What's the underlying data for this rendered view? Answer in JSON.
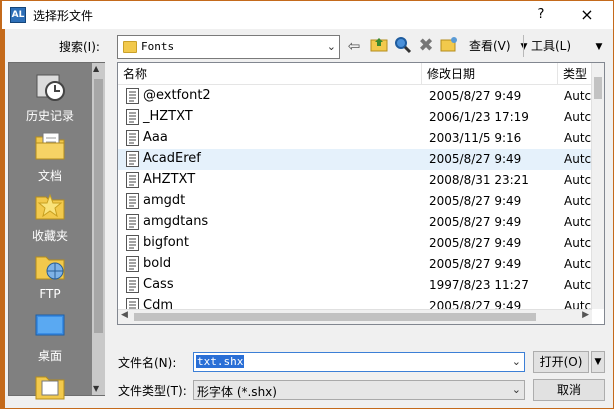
{
  "window": {
    "title": "选择形文件",
    "help_label": "?",
    "close_label": "×",
    "app_icon_text": "AL"
  },
  "toolbar": {
    "search_label": "搜索(I):",
    "current_folder": "Fonts",
    "view_label": "查看(V)",
    "tools_label": "工具(L)",
    "icons": [
      "back-icon",
      "up-folder-icon",
      "search-web-icon",
      "delete-icon",
      "new-folder-icon"
    ]
  },
  "places": [
    {
      "label": "历史记录",
      "icon": "history-icon"
    },
    {
      "label": "文档",
      "icon": "documents-icon"
    },
    {
      "label": "收藏夹",
      "icon": "favorites-icon"
    },
    {
      "label": "FTP",
      "icon": "ftp-icon"
    },
    {
      "label": "桌面",
      "icon": "desktop-icon"
    }
  ],
  "file_list": {
    "columns": [
      "名称",
      "修改日期",
      "类型"
    ],
    "selected_index": 3,
    "rows": [
      {
        "name": "@extfont2",
        "date": "2005/8/27 9:49",
        "type": "Autc"
      },
      {
        "name": "_HZTXT",
        "date": "2006/1/23 17:19",
        "type": "Autc"
      },
      {
        "name": "Aaa",
        "date": "2003/11/5 9:16",
        "type": "Autc"
      },
      {
        "name": "AcadEref",
        "date": "2005/8/27 9:49",
        "type": "Autc"
      },
      {
        "name": "AHZTXT",
        "date": "2008/8/31 23:21",
        "type": "Autc"
      },
      {
        "name": "amgdt",
        "date": "2005/8/27 9:49",
        "type": "Autc"
      },
      {
        "name": "amgdtans",
        "date": "2005/8/27 9:49",
        "type": "Autc"
      },
      {
        "name": "bigfont",
        "date": "2005/8/27 9:49",
        "type": "Autc"
      },
      {
        "name": "bold",
        "date": "2005/8/27 9:49",
        "type": "Autc"
      },
      {
        "name": "Cass",
        "date": "1997/8/23 11:27",
        "type": "Autc"
      },
      {
        "name": "Cdm",
        "date": "2005/8/27 9:49",
        "type": "Autc"
      }
    ]
  },
  "footer": {
    "filename_label": "文件名(N):",
    "filename_value": "txt.shx",
    "filetype_label": "文件类型(T):",
    "filetype_value": "形字体 (*.shx)",
    "open_label": "打开(O)",
    "cancel_label": "取消"
  },
  "colors": {
    "accent_border": "#c46a1b",
    "selection_bg": "#e5f1fb",
    "input_highlight": "#2a6fd6"
  }
}
